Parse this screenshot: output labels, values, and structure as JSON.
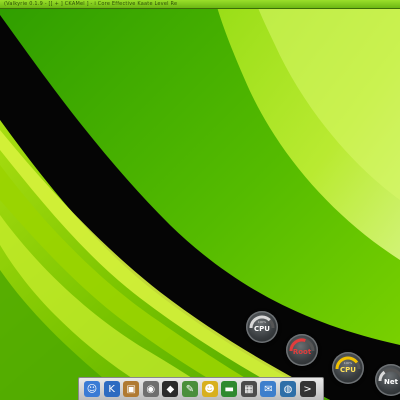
{
  "window": {
    "title": "(Valkyrie 0.1.9 - [[ + ] CKAMel ] - i Core Effective Kaate Level Re"
  },
  "desktop": {
    "wallpaper_colors": [
      "#0c0c0c",
      "#3aa300",
      "#7bd200",
      "#c8f22a"
    ]
  },
  "widgets": {
    "gauges": [
      {
        "label": "CPU",
        "sub": "100%",
        "color": "#ffffff",
        "arc": "#d9d9d9",
        "level": 0.75
      },
      {
        "label": "Root",
        "sub": "",
        "color": "#e23c3c",
        "arc": "#e23c3c",
        "level": 0.6
      },
      {
        "label": "CPU",
        "sub": "100%",
        "color": "#ffe25a",
        "arc": "#f2c200",
        "level": 0.8
      },
      {
        "label": "Net",
        "sub": "",
        "color": "#ffffff",
        "arc": "#d9d9d9",
        "level": 0.3
      }
    ]
  },
  "dock": {
    "items": [
      {
        "name": "finder-icon",
        "glyph": "☺",
        "color": "#3a7bd5"
      },
      {
        "name": "kde-icon",
        "glyph": "K",
        "color": "#2d6bc1"
      },
      {
        "name": "package-icon",
        "glyph": "▣",
        "color": "#b07a32"
      },
      {
        "name": "camera-icon",
        "glyph": "◉",
        "color": "#6e6e6e"
      },
      {
        "name": "tux-icon",
        "glyph": "◆",
        "color": "#2a2a2a"
      },
      {
        "name": "tools-icon",
        "glyph": "✎",
        "color": "#4a8f3a"
      },
      {
        "name": "smiley-icon",
        "glyph": "☻",
        "color": "#d8b01e"
      },
      {
        "name": "terminal-icon",
        "glyph": "▬",
        "color": "#2f8a2f"
      },
      {
        "name": "windows-icon",
        "glyph": "▦",
        "color": "#4c4c4c"
      },
      {
        "name": "mail-icon",
        "glyph": "✉",
        "color": "#3e7fcc"
      },
      {
        "name": "globe-icon",
        "glyph": "◍",
        "color": "#2e6fa8"
      },
      {
        "name": "console-icon",
        "glyph": ">",
        "color": "#333333"
      }
    ]
  }
}
